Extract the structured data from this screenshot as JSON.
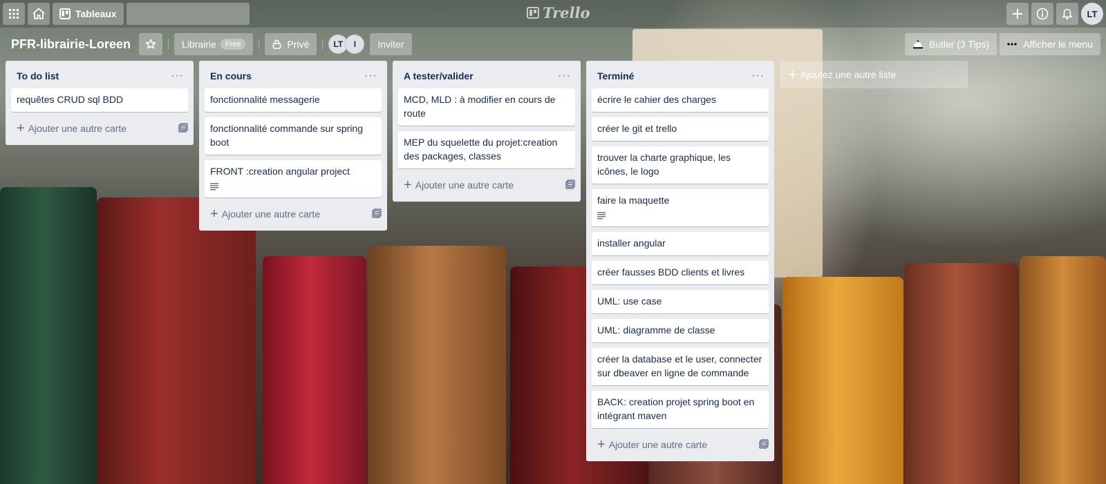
{
  "header": {
    "boards_label": "Tableaux",
    "search_placeholder": "",
    "logo_text": "Trello",
    "avatar_initials": "LT"
  },
  "board": {
    "title": "PFR-librairie-Loreen",
    "team_label": "Librairie",
    "team_badge": "Free",
    "visibility_label": "Privé",
    "members": [
      "LT",
      "I"
    ],
    "invite_label": "Inviter",
    "butler_label": "Butler (3 Tips)",
    "menu_label": "Afficher le menu"
  },
  "lists": [
    {
      "title": "To do list",
      "cards": [
        {
          "text": "requêtes CRUD sql BDD",
          "has_description": false
        }
      ],
      "add_label": "Ajouter une autre carte"
    },
    {
      "title": "En cours",
      "cards": [
        {
          "text": "fonctionnalité messagerie",
          "has_description": false
        },
        {
          "text": "fonctionnalité commande sur spring boot",
          "has_description": false
        },
        {
          "text": "FRONT :creation angular project",
          "has_description": true
        }
      ],
      "add_label": "Ajouter une autre carte"
    },
    {
      "title": "A tester/valider",
      "cards": [
        {
          "text": "MCD, MLD : à modifier en cours de route",
          "has_description": false
        },
        {
          "text": "MEP du squelette du projet:creation des packages, classes",
          "has_description": false
        }
      ],
      "add_label": "Ajouter une autre carte"
    },
    {
      "title": "Terminé",
      "cards": [
        {
          "text": "écrire le cahier des charges",
          "has_description": false
        },
        {
          "text": "créer le git et trello",
          "has_description": false
        },
        {
          "text": "trouver la charte graphique, les icônes, le logo",
          "has_description": false
        },
        {
          "text": "faire la maquette",
          "has_description": true
        },
        {
          "text": "installer angular",
          "has_description": false
        },
        {
          "text": "créer fausses BDD clients et livres",
          "has_description": false
        },
        {
          "text": "UML: use case",
          "has_description": false
        },
        {
          "text": "UML: diagramme de classe",
          "has_description": false
        },
        {
          "text": "créer la database et le user, connecter sur dbeaver en ligne de commande",
          "has_description": false
        },
        {
          "text": "BACK: creation projet spring boot en intégrant maven",
          "has_description": false
        }
      ],
      "add_label": "Ajouter une autre carte"
    }
  ],
  "add_list_label": "Ajoutez une autre liste",
  "icons": {
    "apps": "grid-icon",
    "home": "home-icon",
    "boards": "board-icon",
    "search": "search-icon",
    "create": "plus-icon",
    "info": "info-icon",
    "notifications": "bell-icon",
    "star": "star-icon",
    "lock": "lock-icon",
    "butler": "butler-icon",
    "menu": "ellipsis-icon"
  }
}
